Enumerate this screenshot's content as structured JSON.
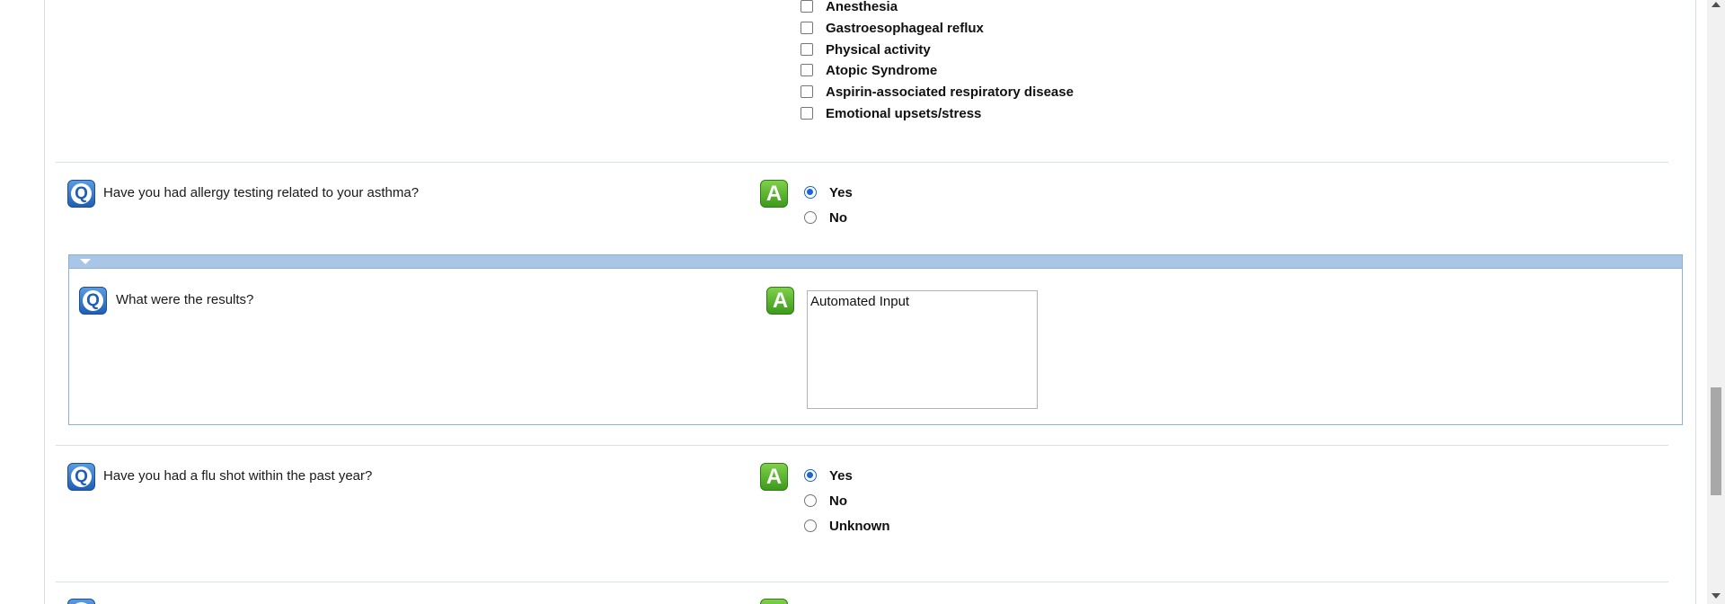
{
  "triggers": {
    "options": [
      {
        "label": "Anesthesia",
        "checked": false
      },
      {
        "label": "Gastroesophageal reflux",
        "checked": false
      },
      {
        "label": "Physical activity",
        "checked": false
      },
      {
        "label": "Atopic Syndrome",
        "checked": false
      },
      {
        "label": "Aspirin-associated respiratory disease",
        "checked": false
      },
      {
        "label": "Emotional upsets/stress",
        "checked": false
      }
    ]
  },
  "icons": {
    "question": "Q",
    "answer": "A"
  },
  "allergy_question": {
    "text": "Have you had allergy testing related to your asthma?",
    "options": [
      {
        "label": "Yes",
        "selected": true
      },
      {
        "label": "No",
        "selected": false
      }
    ]
  },
  "results_question": {
    "text": "What were the results?",
    "answer": "Automated Input"
  },
  "flu_question": {
    "text": "Have you had a flu shot within the past year?",
    "options": [
      {
        "label": "Yes",
        "selected": true
      },
      {
        "label": "No",
        "selected": false
      },
      {
        "label": "Unknown",
        "selected": false
      }
    ]
  },
  "colors": {
    "accent": "#1a66d0",
    "question_icon": "#1d5fb5",
    "answer_icon": "#3c9a1c",
    "subpanel_header": "#a9c6e6"
  }
}
